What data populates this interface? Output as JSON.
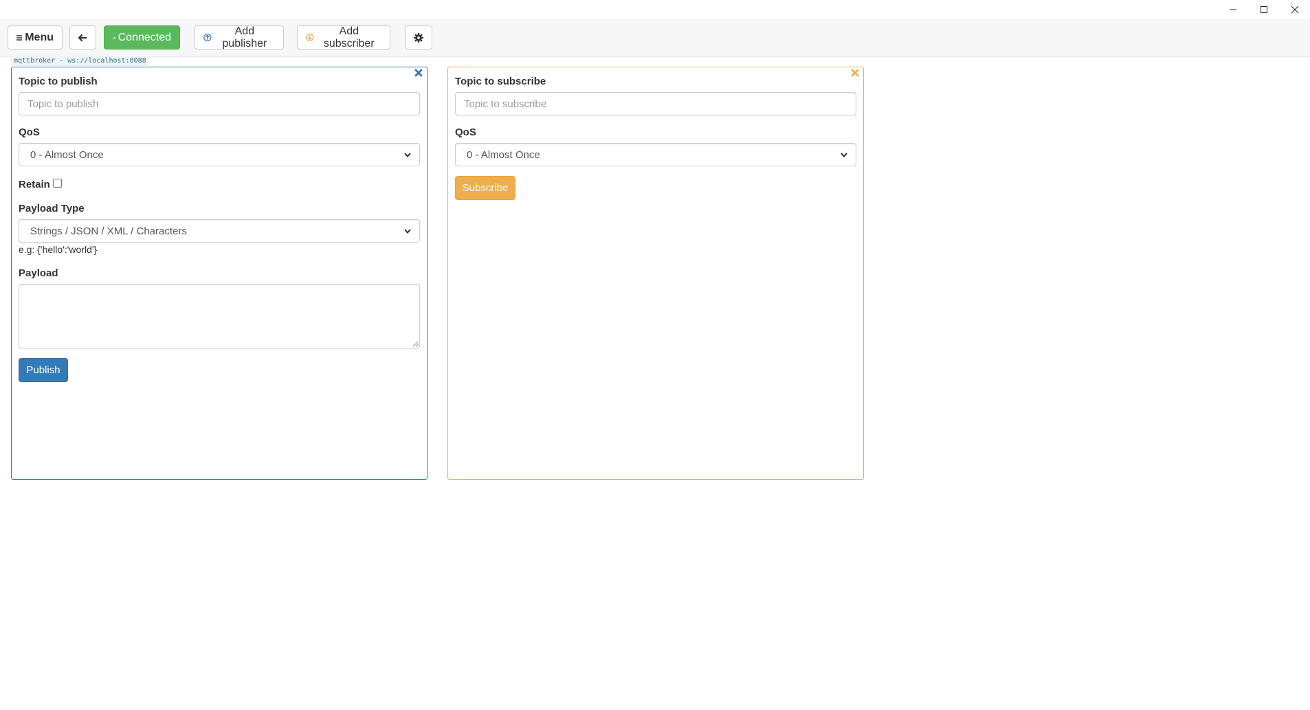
{
  "toolbar": {
    "menu_label": "Menu",
    "connected_label": "Connected",
    "add_publisher_label": "Add publisher",
    "add_subscriber_label": "Add subscriber"
  },
  "broker": {
    "label": "mqttbroker - ws://localhost:8088"
  },
  "publisher": {
    "topic_label": "Topic to publish",
    "topic_placeholder": "Topic to publish",
    "topic_value": "",
    "qos_label": "QoS",
    "qos_selected": "0 - Almost Once",
    "retain_label": "Retain",
    "retain_checked": false,
    "payload_type_label": "Payload Type",
    "payload_type_selected": "Strings / JSON / XML / Characters",
    "payload_hint": "e.g: {'hello':'world'}",
    "payload_label": "Payload",
    "payload_value": "",
    "publish_label": "Publish"
  },
  "subscriber": {
    "topic_label": "Topic to subscribe",
    "topic_placeholder": "Topic to subscribe",
    "topic_value": "",
    "qos_label": "QoS",
    "qos_selected": "0 - Almost Once",
    "subscribe_label": "Subscribe"
  },
  "colors": {
    "publisher_accent": "#337ab7",
    "subscriber_accent": "#f0ad4e",
    "connected": "#5cb85c"
  },
  "icons": {
    "menu": "hamburger-icon",
    "back": "arrow-left-icon",
    "connected": "signal-bars-icon",
    "add_publisher": "circle-arrow-up-icon",
    "add_subscriber": "circle-arrow-down-icon",
    "settings": "gear-icon",
    "close": "close-icon"
  }
}
